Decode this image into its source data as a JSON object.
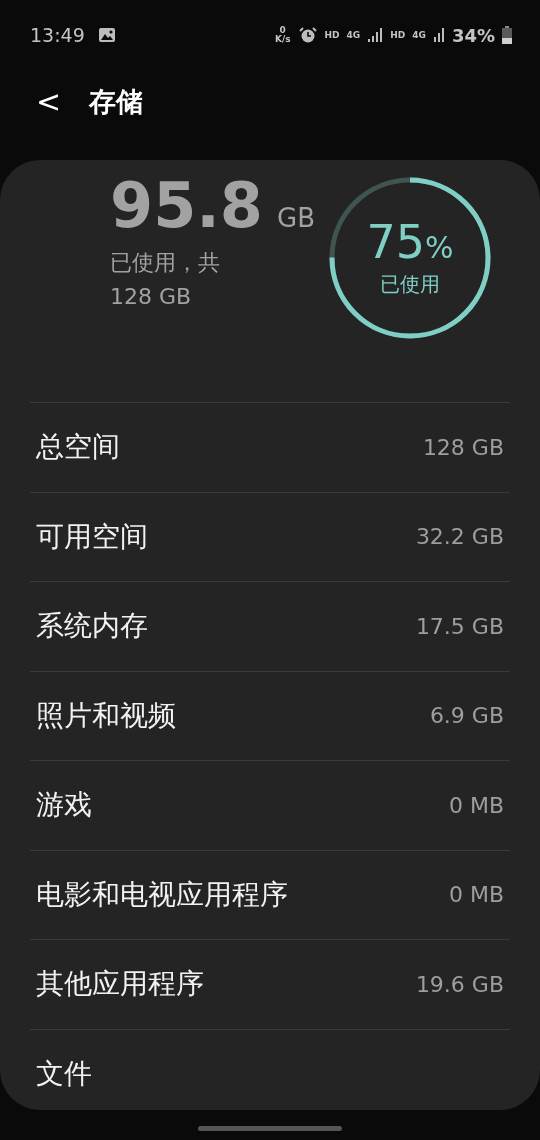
{
  "status_bar": {
    "time": "13:49",
    "speed_value": "0",
    "speed_unit": "K/s",
    "network_1": "HD",
    "network_1_type": "4G",
    "network_2": "HD",
    "network_2_type": "4G",
    "battery": "34%"
  },
  "header": {
    "back": "<",
    "title": "存储"
  },
  "summary": {
    "used_value": "95.8",
    "used_unit": "GB",
    "caption_1": "已使用，共",
    "caption_2": "128 GB",
    "percent": "75",
    "percent_sign": "%",
    "ring_label": "已使用",
    "level": 0.75
  },
  "rows": [
    {
      "label": "总空间",
      "value": "128 GB"
    },
    {
      "label": "可用空间",
      "value": "32.2 GB"
    },
    {
      "label": "系统内存",
      "value": "17.5 GB"
    },
    {
      "label": "照片和视频",
      "value": "6.9 GB"
    },
    {
      "label": "游戏",
      "value": "0 MB"
    },
    {
      "label": "电影和电视应用程序",
      "value": "0 MB"
    },
    {
      "label": "其他应用程序",
      "value": "19.6 GB"
    },
    {
      "label": "文件"
    }
  ]
}
